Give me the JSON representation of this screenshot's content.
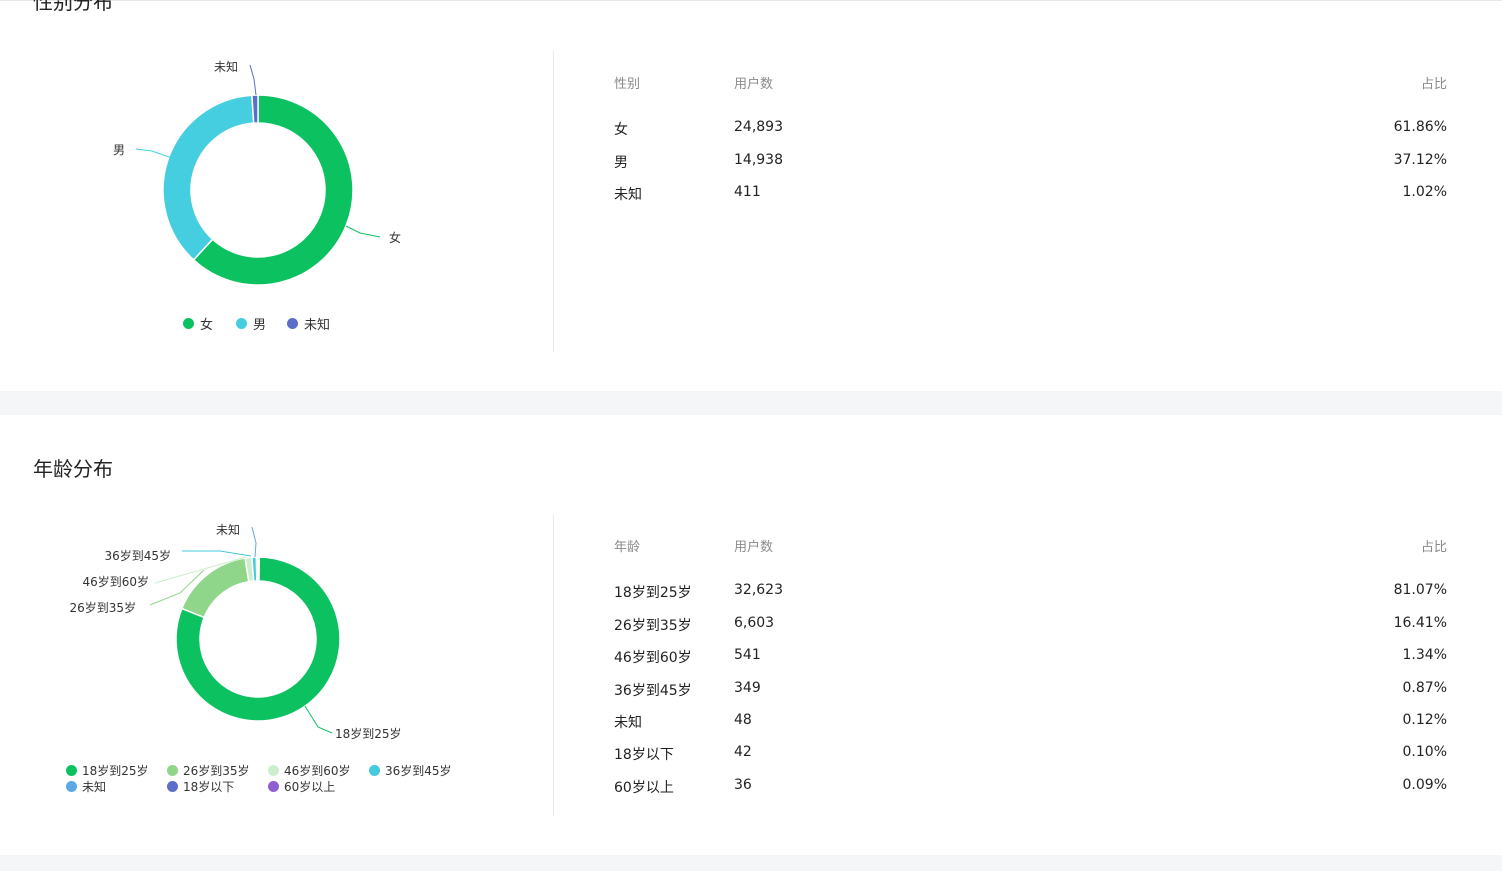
{
  "gender": {
    "title": "性别分布",
    "table_headers": {
      "col1": "性别",
      "col2": "用户数",
      "col3": "占比"
    },
    "rows": [
      {
        "label": "女",
        "count": "24,893",
        "pct": "61.86%"
      },
      {
        "label": "男",
        "count": "14,938",
        "pct": "37.12%"
      },
      {
        "label": "未知",
        "count": "411",
        "pct": "1.02%"
      }
    ],
    "legend": [
      "女",
      "男",
      "未知"
    ],
    "colors": [
      "#0cc160",
      "#45cde0",
      "#5b6fc9"
    ]
  },
  "age": {
    "title": "年龄分布",
    "table_headers": {
      "col1": "年龄",
      "col2": "用户数",
      "col3": "占比"
    },
    "rows": [
      {
        "label": "18岁到25岁",
        "count": "32,623",
        "pct": "81.07%"
      },
      {
        "label": "26岁到35岁",
        "count": "6,603",
        "pct": "16.41%"
      },
      {
        "label": "46岁到60岁",
        "count": "541",
        "pct": "1.34%"
      },
      {
        "label": "36岁到45岁",
        "count": "349",
        "pct": "0.87%"
      },
      {
        "label": "未知",
        "count": "48",
        "pct": "0.12%"
      },
      {
        "label": "18岁以下",
        "count": "42",
        "pct": "0.10%"
      },
      {
        "label": "60岁以上",
        "count": "36",
        "pct": "0.09%"
      }
    ],
    "legend": [
      "18岁到25岁",
      "26岁到35岁",
      "46岁到60岁",
      "36岁到45岁",
      "未知",
      "18岁以下",
      "60岁以上"
    ],
    "colors": [
      "#0cc160",
      "#8fd68b",
      "#cdeecd",
      "#45c9dc",
      "#5aa9e6",
      "#5b6fc9",
      "#8e5fd3"
    ]
  },
  "chart_data": [
    {
      "type": "pie",
      "title": "性别分布",
      "categories": [
        "女",
        "男",
        "未知"
      ],
      "values": [
        24893,
        14938,
        411
      ],
      "percent": [
        61.86,
        37.12,
        1.02
      ],
      "legend_position": "bottom"
    },
    {
      "type": "pie",
      "title": "年龄分布",
      "categories": [
        "18岁到25岁",
        "26岁到35岁",
        "46岁到60岁",
        "36岁到45岁",
        "未知",
        "18岁以下",
        "60岁以上"
      ],
      "values": [
        32623,
        6603,
        541,
        349,
        48,
        42,
        36
      ],
      "percent": [
        81.07,
        16.41,
        1.34,
        0.87,
        0.12,
        0.1,
        0.09
      ],
      "legend_position": "bottom"
    }
  ]
}
